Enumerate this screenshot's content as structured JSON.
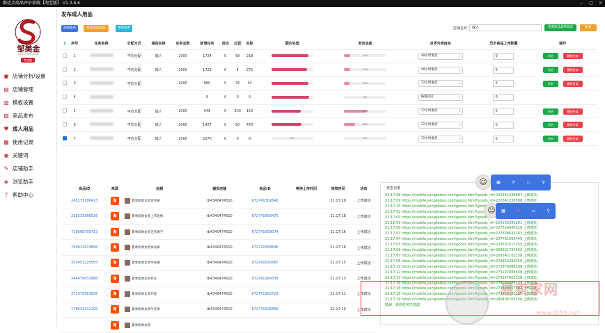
{
  "window": {
    "title": "都达点商品评价系统【淘宝版】 V1.3.8.6",
    "controls": [
      "—",
      "□",
      "✕"
    ]
  },
  "brand": {
    "name": "邹美金",
    "subtitle": "Speed Innovation",
    "badge": "专业版"
  },
  "nav": [
    {
      "label": "店铺分析/设置",
      "icon": "shop-icon"
    },
    {
      "label": "店铺管理",
      "icon": "store-icon"
    },
    {
      "label": "模板设置",
      "icon": "template-icon"
    },
    {
      "label": "商品发布",
      "icon": "publish-icon"
    },
    {
      "label": "成人用品",
      "icon": "product-icon",
      "active": true
    },
    {
      "label": "使用记录",
      "icon": "record-icon"
    },
    {
      "label": "关键词",
      "icon": "keyword-icon"
    },
    {
      "label": "店铺助手",
      "icon": "helper-icon"
    },
    {
      "label": "浏览助手",
      "icon": "browse-icon"
    },
    {
      "label": "帮助中心",
      "icon": "help-icon"
    }
  ],
  "page": {
    "title": "发布成人用品"
  },
  "toolbar": {
    "buttons": [
      {
        "label": "添加任务",
        "color": "#3f74e0"
      },
      {
        "label": "批量添加商品",
        "color": "#f2a12c"
      },
      {
        "label": "清空任务",
        "color": "#29b8d8"
      }
    ],
    "store_label": "店铺名称：",
    "store_value": "成人",
    "detect_label": "检测商品发布状态",
    "more_label": "更多"
  },
  "task_table": {
    "headers": [
      "",
      "序号",
      "任务名称",
      "分配方式",
      "铺货名称",
      "任务总数",
      "新增任务",
      "成功",
      "过滤",
      "失败",
      "图片处理",
      "发布进度",
      "点评分类目标",
      "历史商品上传数量",
      "操作"
    ],
    "rows": [
      {
        "checked": false,
        "seq": "1",
        "mode": "平均分配",
        "shop": "成人",
        "total": "2000",
        "added": "1724",
        "ok": "0",
        "filter": "58",
        "fail": "218",
        "p1": "",
        "p1v": 0.88,
        "p2": "14%",
        "p2v": 0.14,
        "sel": "48小时发货",
        "count": "0",
        "actions": true
      },
      {
        "checked": false,
        "seq": "2",
        "mode": "平均分配",
        "shop": "成人",
        "total": "2000",
        "added": "1721",
        "ok": "0",
        "filter": "4",
        "fail": "275",
        "p1": "",
        "p1v": 0.86,
        "p2": "14%",
        "p2v": 0.14,
        "sel": "48小时发货",
        "count": "0",
        "actions": true
      },
      {
        "checked": false,
        "seq": "3",
        "mode": "平均分配",
        "shop": "",
        "total": "1000",
        "added": "880",
        "ok": "0",
        "filter": "76",
        "fail": "44",
        "p1": "",
        "p1v": 0.88,
        "p2": "12%",
        "p2v": 0.12,
        "sel": "72小时发货",
        "count": "0",
        "actions": true
      },
      {
        "checked": false,
        "seq": "4",
        "mode": "",
        "shop": "",
        "total": "",
        "added": "0",
        "ok": "0",
        "filter": "0",
        "fail": "0",
        "p1": "",
        "p1v": 0.9,
        "p2": "0%",
        "p2v": 0,
        "sel": "按铺货店",
        "count": "0",
        "actions": false
      },
      {
        "checked": false,
        "seq": "5",
        "mode": "平均分配",
        "shop": "成人",
        "total": "1000",
        "added": "548",
        "ok": "0",
        "filter": "303",
        "fail": "150",
        "p1": "",
        "p1v": 0.7,
        "p2": "55%",
        "p2v": 0.55,
        "sel": "72小时发货",
        "count": "0",
        "actions": true
      },
      {
        "checked": false,
        "seq": "6",
        "mode": "平均分配",
        "shop": "成人",
        "total": "2000",
        "added": "1427",
        "ok": "0",
        "filter": "50",
        "fail": "470",
        "p1": "",
        "p1v": 0.72,
        "p2": "26%",
        "p2v": 0.26,
        "sel": "72小时发货",
        "count": "0",
        "actions": true
      },
      {
        "checked": true,
        "seq": "7",
        "mode": "平均分配",
        "shop": "成人",
        "total": "2000",
        "added": "2070",
        "ok": "0",
        "filter": "0",
        "fail": "0",
        "p1": "0%",
        "p1v": 0,
        "p2": "0%",
        "p2v": 0,
        "sel": "72小时发货",
        "count": "0",
        "actions": true
      }
    ],
    "btn_start": "开始",
    "btn_delete": "删除任务"
  },
  "order_table": {
    "headers": [
      "商品ID",
      "来源",
      "标题",
      "铺货店铺",
      "商品ID",
      "等待上传时间",
      "审核时间",
      "状态"
    ],
    "rows": [
      {
        "id": "243173186423",
        "src": "淘",
        "title": "夏季新款女装连衣裙",
        "shop": "tb4340474510",
        "pid": "672741302640",
        "time": "21:17:19",
        "status": "上传成功"
      },
      {
        "id": "258333566526",
        "src": "淘",
        "title": "夏季新款女装上衣短裤",
        "shop": "tb4340474510",
        "pid": "672741658475",
        "time": "21:17:18",
        "status": "上传成功"
      },
      {
        "id": "716668799713",
        "src": "淘",
        "title": "夏季新款女装连衣裙子",
        "shop": "tb4340474510",
        "pid": "672741659074",
        "time": "21:17:16",
        "status": "上传成功"
      },
      {
        "id": "740612613858",
        "src": "淘",
        "title": "夏季新款女装休闲裤",
        "shop": "tb4340474510",
        "pid": "672741558846",
        "time": "21:17:16",
        "status": "上传成功"
      },
      {
        "id": "203451225055",
        "src": "淘",
        "title": "夏季新款女装半身裙",
        "shop": "tb4340474510",
        "pid": "672741520687",
        "time": "21:17:15",
        "status": "上传成功"
      },
      {
        "id": "244479031888",
        "src": "淘",
        "title": "夏季新款女装衬衫",
        "shop": "tb4340474510",
        "pid": "672741264339",
        "time": "21:17:13",
        "status": "上传成功"
      },
      {
        "id": "271370563826",
        "src": "淘",
        "title": "夏季新款女装外套",
        "shop": "tb4340474510",
        "pid": "672741262722",
        "time": "21:17:11",
        "status": "上传成功"
      },
      {
        "id": "178633322109",
        "src": "淘",
        "title": "夏季新款女装牛仔裤",
        "shop": "tb4340474510",
        "pid": "672741526856",
        "time": "21:17:10",
        "status": "上传成功"
      },
      {
        "id": "",
        "src": "淘",
        "title": "夏季新款女装",
        "shop": "",
        "pid": "",
        "time": "",
        "status": ""
      }
    ]
  },
  "log": {
    "title": "日志记录",
    "lines": [
      "21:17:08 https://mobile.yangkeduo.com/goods.html?goods_id=220341236587 上传成功",
      "21:17:09 https://mobile.yangkeduo.com/goods.html?goods_id=220341236588 上传成功",
      "21:17:10 https://mobile.yangkeduo.com/goods.html?goods_id=221823567412 上传成功",
      "21:17:02 https://mobile.yangkeduo.com/goods.html?goods_id=225062358962 上传成功",
      "21:17:00 https://mobile.yangkeduo.com/goods.html?goods_id=225081245689 上传成功",
      "21:16:59 https://mobile.yangkeduo.com/goods.html?goods_id=224156385261 上传成功",
      "21:17:00 https://mobile.yangkeduo.com/goods.html?goods_id=227516045128 上传成功",
      "21:17:02 https://mobile.yangkeduo.com/goods.html?goods_id=227638642163 上传成功",
      "21:17:04 https://mobile.yangkeduo.com/goods.html?goods_id=227761665449 上传成功",
      "21:17:05 https://mobile.yangkeduo.com/goods.html?goods_id=228531017255 上传成功",
      "21:17:06 https://mobile.yangkeduo.com/goods.html?goods_id=268921787462 上传成功",
      "21:17:07 https://mobile.yangkeduo.com/goods.html?goods_id=269342162158 上传成功",
      "21:17:08 https://mobile.yangkeduo.com/goods.html?goods_id=276853383158 上传成功",
      "21:17:11 https://mobile.yangkeduo.com/goods.html?goods_id=273876988198 上传成功",
      "21:17:12 https://mobile.yangkeduo.com/goods.html?goods_id=275197885638 上传成功",
      "21:17:13 https://mobile.yangkeduo.com/goods.html?goods_id=276347663158 上传成功",
      "21:17:16 https://mobile.yangkeduo.com/goods.html?goods_id=278034385131 上传成功",
      "21:17:16 https://mobile.yangkeduo.com/goods.html?goods_id=279538637582 上传成功",
      "21:17:18 https://mobile.yangkeduo.com/goods.html?goods_id=279654236165 上传成功",
      "21:17:19 https://mobile.yangkeduo.com/goods.html?goods_id=280436765156 上传成功",
      "错误：目前任务已完成"
    ]
  },
  "floatbar": {
    "icons": [
      "grid-icon",
      "refresh-icon",
      "chat-icon",
      "search-icon"
    ]
  },
  "watermark": {
    "text": "易卖家网",
    "url": "www.tb55.net"
  }
}
